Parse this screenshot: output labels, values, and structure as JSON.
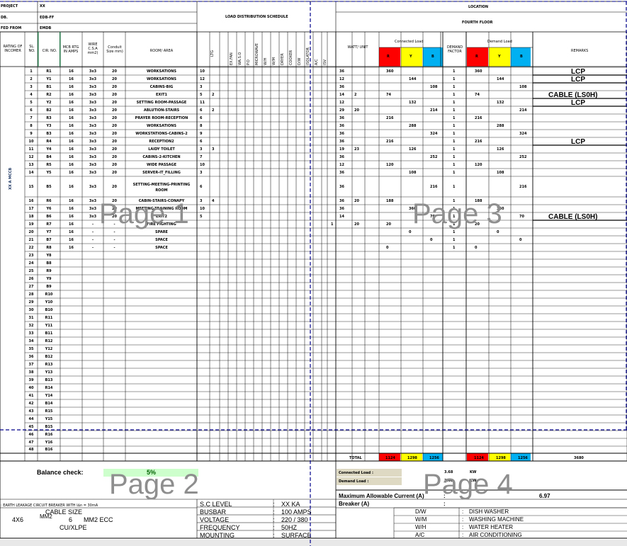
{
  "header": {
    "project_label": "PROJECT",
    "project_value": "XX",
    "db_label": "DB.",
    "db_value": "EDB-FF",
    "fed_label": "FED FROM",
    "fed_value": "EMDB",
    "title": "LOAD DISTRIBUTION SCHEDULE",
    "location_label": "LOCATION",
    "location_value": "FOURTH FLOOR"
  },
  "columns": {
    "rating": "RATING OF INCOMER",
    "sl": "SL. NO.",
    "cir": "CIR. NO.",
    "mcb": "MCB RTG IN AMPS",
    "wire": "WIRE C.S.A mm2)",
    "conduit": "Conduit Size mm)",
    "room": "ROOM/ AREA",
    "vertical": [
      "LTG",
      "EX.FAN",
      "WA.S.O",
      "P.O",
      "MICROWAVE",
      "W/H",
      "W/M",
      "DRYER",
      "COOKER",
      "D/W",
      "ISOLATOR",
      "A/C",
      "ISV"
    ],
    "watt": "WATT/ UNIT",
    "connected": "Connected Load",
    "demand_factor": "DEMAND FACTOR",
    "demand_load": "Demand Load",
    "phase_r": "R",
    "phase_y": "Y",
    "phase_b": "B",
    "remarks": "REMARKS",
    "incomer_side": "XX    A MCCB"
  },
  "rows": [
    {
      "sl": "1",
      "cir": "R1",
      "mcb": "16",
      "wire": "3x3",
      "cond": "20",
      "room": "WORKSATIONS",
      "ltg": "10",
      "c2": "",
      "watt": "36",
      "w2": "",
      "r": "360",
      "y": "",
      "b": "",
      "df": "1",
      "dr": "360",
      "dy": "",
      "db": "",
      "rem": "LCP"
    },
    {
      "sl": "2",
      "cir": "Y1",
      "mcb": "16",
      "wire": "3x3",
      "cond": "20",
      "room": "WORKSATIONS",
      "ltg": "12",
      "c2": "",
      "watt": "12",
      "w2": "",
      "r": "",
      "y": "144",
      "b": "",
      "df": "1",
      "dr": "",
      "dy": "144",
      "db": "",
      "rem": "LCP"
    },
    {
      "sl": "3",
      "cir": "B1",
      "mcb": "16",
      "wire": "3x3",
      "cond": "20",
      "room": "CABINS-BIG",
      "ltg": "3",
      "c2": "",
      "watt": "36",
      "w2": "",
      "r": "",
      "y": "",
      "b": "108",
      "df": "1",
      "dr": "",
      "dy": "",
      "db": "108",
      "rem": ""
    },
    {
      "sl": "4",
      "cir": "R2",
      "mcb": "16",
      "wire": "3x3",
      "cond": "20",
      "room": "EXIT1",
      "ltg": "5",
      "c2": "2",
      "watt": "14",
      "w2": "2",
      "r": "74",
      "y": "",
      "b": "",
      "df": "1",
      "dr": "74",
      "dy": "",
      "db": "",
      "rem": "CABLE (LS0H)"
    },
    {
      "sl": "5",
      "cir": "Y2",
      "mcb": "16",
      "wire": "3x3",
      "cond": "20",
      "room": "SETTING ROOM-PASSAGE",
      "ltg": "11",
      "c2": "",
      "watt": "12",
      "w2": "",
      "r": "",
      "y": "132",
      "b": "",
      "df": "1",
      "dr": "",
      "dy": "132",
      "db": "",
      "rem": "LCP"
    },
    {
      "sl": "6",
      "cir": "B2",
      "mcb": "16",
      "wire": "3x3",
      "cond": "20",
      "room": "ABLUTION-STAIRS",
      "ltg": "6",
      "c2": "2",
      "watt": "29",
      "w2": "20",
      "r": "",
      "y": "",
      "b": "214",
      "df": "1",
      "dr": "",
      "dy": "",
      "db": "214",
      "rem": ""
    },
    {
      "sl": "7",
      "cir": "R3",
      "mcb": "16",
      "wire": "3x3",
      "cond": "20",
      "room": "PRAYER ROOM-RECEPTION",
      "ltg": "6",
      "c2": "",
      "watt": "36",
      "w2": "",
      "r": "216",
      "y": "",
      "b": "",
      "df": "1",
      "dr": "216",
      "dy": "",
      "db": "",
      "rem": ""
    },
    {
      "sl": "8",
      "cir": "Y3",
      "mcb": "16",
      "wire": "3x3",
      "cond": "20",
      "room": "WORKSATIONS",
      "ltg": "8",
      "c2": "",
      "watt": "36",
      "w2": "",
      "r": "",
      "y": "288",
      "b": "",
      "df": "1",
      "dr": "",
      "dy": "288",
      "db": "",
      "rem": ""
    },
    {
      "sl": "9",
      "cir": "B3",
      "mcb": "16",
      "wire": "3x3",
      "cond": "20",
      "room": "WORKSTATIONS-CABINS-2",
      "ltg": "9",
      "c2": "",
      "watt": "36",
      "w2": "",
      "r": "",
      "y": "",
      "b": "324",
      "df": "1",
      "dr": "",
      "dy": "",
      "db": "324",
      "rem": ""
    },
    {
      "sl": "10",
      "cir": "R4",
      "mcb": "16",
      "wire": "3x3",
      "cond": "20",
      "room": "RECEPTION2",
      "ltg": "6",
      "c2": "",
      "watt": "36",
      "w2": "",
      "r": "216",
      "y": "",
      "b": "",
      "df": "1",
      "dr": "216",
      "dy": "",
      "db": "",
      "rem": "LCP"
    },
    {
      "sl": "11",
      "cir": "Y4",
      "mcb": "16",
      "wire": "3x3",
      "cond": "20",
      "room": "LAIDY TOILET",
      "ltg": "3",
      "c2": "3",
      "watt": "19",
      "w2": "23",
      "r": "",
      "y": "126",
      "b": "",
      "df": "1",
      "dr": "",
      "dy": "126",
      "db": "",
      "rem": ""
    },
    {
      "sl": "12",
      "cir": "B4",
      "mcb": "16",
      "wire": "3x3",
      "cond": "20",
      "room": "CABINS-2-KITCHEN",
      "ltg": "7",
      "c2": "",
      "watt": "36",
      "w2": "",
      "r": "",
      "y": "",
      "b": "252",
      "df": "1",
      "dr": "",
      "dy": "",
      "db": "252",
      "rem": ""
    },
    {
      "sl": "13",
      "cir": "R5",
      "mcb": "16",
      "wire": "3x3",
      "cond": "20",
      "room": "WIDE PASSAGE",
      "ltg": "10",
      "c2": "",
      "watt": "12",
      "w2": "",
      "r": "120",
      "y": "",
      "b": "",
      "df": "1",
      "dr": "120",
      "dy": "",
      "db": "",
      "rem": ""
    },
    {
      "sl": "14",
      "cir": "Y5",
      "mcb": "16",
      "wire": "3x3",
      "cond": "20",
      "room": "SERVER-IT_FILLING",
      "ltg": "3",
      "c2": "",
      "watt": "36",
      "w2": "",
      "r": "",
      "y": "108",
      "b": "",
      "df": "1",
      "dr": "",
      "dy": "108",
      "db": "",
      "rem": ""
    },
    {
      "sl": "15",
      "cir": "B5",
      "mcb": "16",
      "wire": "3x3",
      "cond": "20",
      "room": "SETTING-MEETING-PRINTING ROOM",
      "ltg": "6",
      "c2": "",
      "watt": "36",
      "w2": "",
      "r": "",
      "y": "",
      "b": "216",
      "df": "1",
      "dr": "",
      "dy": "",
      "db": "216",
      "rem": ""
    },
    {
      "sl": "16",
      "cir": "R6",
      "mcb": "16",
      "wire": "3x3",
      "cond": "20",
      "room": "CABIN-STAIRS-CONAPY",
      "ltg": "3",
      "c2": "4",
      "watt": "36",
      "w2": "20",
      "r": "188",
      "y": "",
      "b": "",
      "df": "1",
      "dr": "188",
      "dy": "",
      "db": "",
      "rem": ""
    },
    {
      "sl": "17",
      "cir": "Y6",
      "mcb": "16",
      "wire": "3x3",
      "cond": "20",
      "room": "MEETING-TRAINING ROOM",
      "ltg": "10",
      "c2": "",
      "watt": "36",
      "w2": "",
      "r": "",
      "y": "360",
      "b": "",
      "df": "1",
      "dr": "",
      "dy": "360",
      "db": "",
      "rem": ""
    },
    {
      "sl": "18",
      "cir": "B6",
      "mcb": "16",
      "wire": "3x3",
      "cond": "20",
      "room": "EXIT2",
      "ltg": "5",
      "c2": "",
      "watt": "14",
      "w2": "",
      "r": "",
      "y": "",
      "b": "70",
      "df": "1",
      "dr": "",
      "dy": "",
      "db": "70",
      "rem": "CABLE (LS0H)"
    },
    {
      "sl": "19",
      "cir": "R7",
      "mcb": "16",
      "wire": "-",
      "cond": "-",
      "room": "FIRE FIGHTING",
      "ltg": "",
      "c2": "",
      "watt": "",
      "w2": "20",
      "r": "20",
      "y": "",
      "b": "",
      "df": "1",
      "dr": "20",
      "dy": "",
      "db": "",
      "rem": "",
      "extra": "1"
    },
    {
      "sl": "20",
      "cir": "Y7",
      "mcb": "16",
      "wire": "-",
      "cond": "-",
      "room": "SPARE",
      "ltg": "",
      "c2": "",
      "watt": "",
      "w2": "",
      "r": "",
      "y": "0",
      "b": "",
      "df": "1",
      "dr": "",
      "dy": "0",
      "db": "",
      "rem": ""
    },
    {
      "sl": "21",
      "cir": "B7",
      "mcb": "16",
      "wire": "-",
      "cond": "-",
      "room": "SPACE",
      "ltg": "",
      "c2": "",
      "watt": "",
      "w2": "",
      "r": "",
      "y": "",
      "b": "0",
      "df": "1",
      "dr": "",
      "dy": "",
      "db": "0",
      "rem": ""
    },
    {
      "sl": "22",
      "cir": "R8",
      "mcb": "16",
      "wire": "-",
      "cond": "-",
      "room": "SPACE",
      "ltg": "",
      "c2": "",
      "watt": "",
      "w2": "",
      "r": "0",
      "y": "",
      "b": "",
      "df": "1",
      "dr": "0",
      "dy": "",
      "db": "",
      "rem": ""
    },
    {
      "sl": "23",
      "cir": "Y8"
    },
    {
      "sl": "24",
      "cir": "B8"
    },
    {
      "sl": "25",
      "cir": "R9"
    },
    {
      "sl": "26",
      "cir": "Y9"
    },
    {
      "sl": "27",
      "cir": "B9"
    },
    {
      "sl": "28",
      "cir": "R10"
    },
    {
      "sl": "29",
      "cir": "Y10"
    },
    {
      "sl": "30",
      "cir": "B10"
    },
    {
      "sl": "31",
      "cir": "R11"
    },
    {
      "sl": "32",
      "cir": "Y11"
    },
    {
      "sl": "33",
      "cir": "B11"
    },
    {
      "sl": "34",
      "cir": "R12"
    },
    {
      "sl": "35",
      "cir": "Y12"
    },
    {
      "sl": "36",
      "cir": "B12"
    },
    {
      "sl": "37",
      "cir": "R13"
    },
    {
      "sl": "38",
      "cir": "Y13"
    },
    {
      "sl": "39",
      "cir": "B13"
    },
    {
      "sl": "40",
      "cir": "R14"
    },
    {
      "sl": "41",
      "cir": "Y14"
    },
    {
      "sl": "42",
      "cir": "B14"
    },
    {
      "sl": "43",
      "cir": "R15"
    },
    {
      "sl": "44",
      "cir": "Y15"
    },
    {
      "sl": "45",
      "cir": "B15"
    },
    {
      "sl": "46",
      "cir": "R16"
    },
    {
      "sl": "47",
      "cir": "Y16"
    },
    {
      "sl": "48",
      "cir": "B16"
    }
  ],
  "totals": {
    "label": "TOTAL",
    "r": "1124",
    "y": "1298",
    "b": "1256",
    "dr": "1124",
    "dy": "1298",
    "db": "1256",
    "remarks": "3680"
  },
  "summary": {
    "balance_label": "Balance check:",
    "balance_value": "5%",
    "connected_label": "Connected Load :",
    "connected_value": "3.68",
    "connected_unit": "KW",
    "demand_label": "Demand Load :",
    "demand_value": "3.68",
    "demand_unit": "KW",
    "max_current_label": "Maximum Allowable Current (A)",
    "max_current_sep": ":",
    "max_current_value": "6.97",
    "breaker_label": "Breaker (A)",
    "breaker_sep": ":"
  },
  "footer": {
    "elcb_note": ": EARTH LEAKAGE CIRCUIT BREAKER WITH I∆n = 30mA",
    "cable_size_label": "CABLE SIZE",
    "cable_qty": "4X6",
    "cable_overlap": "MM2",
    "cable_mid": "6",
    "cable_spec": "MM2 ECC",
    "cable_type": "CU/XLPE",
    "sc_label": "S.C LEVEL",
    "sc_value": "XX   KA",
    "busbar_label": "BUSBAR",
    "busbar_value": "100  AMPS",
    "voltage_label": "VOLTAGE",
    "voltage_value": "220  /   380",
    "freq_label": "FREQUENCY",
    "freq_value": "50HZ",
    "mount_label": "MOUNTING",
    "mount_value": "SURFACE",
    "colon": ":",
    "legend": [
      {
        "abbr": "D/W",
        "desc": "DISH WASHER"
      },
      {
        "abbr": "W/M",
        "desc": "WASHING MACHINE"
      },
      {
        "abbr": "W/H",
        "desc": "WATER HEATER"
      },
      {
        "abbr": "A/C",
        "desc": "AIR CONDITIONING"
      }
    ]
  },
  "watermarks": {
    "p1": "Page 1",
    "p2": "Page 2",
    "p3": "Page 3",
    "p4": "Page 4"
  },
  "colors": {
    "red": "#ff0000",
    "yellow": "#ffff00",
    "blue": "#00b0f0",
    "green_cell": "#ccffcc",
    "tan_cell": "#ddd9c3",
    "pagebreak": "#00008b"
  }
}
